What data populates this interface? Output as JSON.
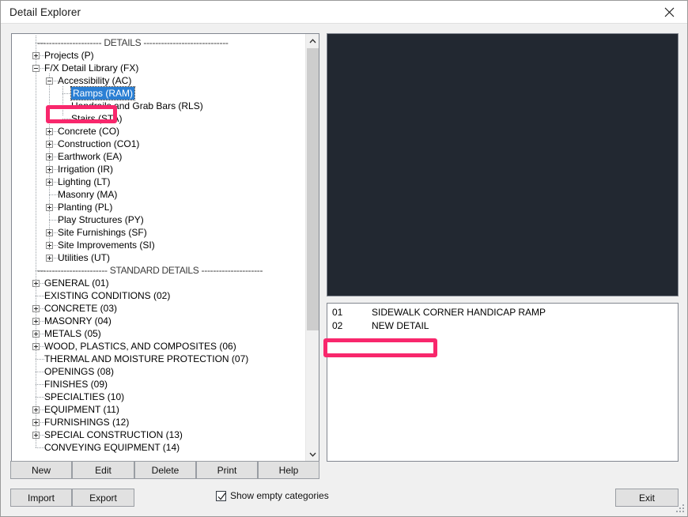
{
  "window": {
    "title": "Detail Explorer",
    "close_icon": "close-icon"
  },
  "tree": {
    "header_separator": "---------------------- DETAILS -----------------------------",
    "standard_separator": "------------------------ STANDARD DETAILS ---------------------",
    "selected_item": "Ramps (RAM)",
    "items": [
      {
        "label": "---------------------- DETAILS -----------------------------",
        "depth": 0,
        "toggle": "none",
        "type": "separator"
      },
      {
        "label": "Projects (P)",
        "depth": 0,
        "toggle": "plus"
      },
      {
        "label": "F/X Detail Library (FX)",
        "depth": 0,
        "toggle": "minus"
      },
      {
        "label": "Accessibility (AC)",
        "depth": 1,
        "toggle": "minus"
      },
      {
        "label": "Ramps (RAM)",
        "depth": 2,
        "toggle": "none",
        "selected": true
      },
      {
        "label": "Handrails and Grab Bars (RLS)",
        "depth": 2,
        "toggle": "none"
      },
      {
        "label": "Stairs (STA)",
        "depth": 2,
        "toggle": "none"
      },
      {
        "label": "Concrete (CO)",
        "depth": 1,
        "toggle": "plus"
      },
      {
        "label": "Construction (CO1)",
        "depth": 1,
        "toggle": "plus"
      },
      {
        "label": "Earthwork (EA)",
        "depth": 1,
        "toggle": "plus"
      },
      {
        "label": "Irrigation (IR)",
        "depth": 1,
        "toggle": "plus"
      },
      {
        "label": "Lighting (LT)",
        "depth": 1,
        "toggle": "plus"
      },
      {
        "label": "Masonry (MA)",
        "depth": 1,
        "toggle": "none"
      },
      {
        "label": "Planting (PL)",
        "depth": 1,
        "toggle": "plus"
      },
      {
        "label": "Play Structures (PY)",
        "depth": 1,
        "toggle": "none"
      },
      {
        "label": "Site Furnishings (SF)",
        "depth": 1,
        "toggle": "plus"
      },
      {
        "label": "Site Improvements (SI)",
        "depth": 1,
        "toggle": "plus"
      },
      {
        "label": "Utilities (UT)",
        "depth": 1,
        "toggle": "plus"
      },
      {
        "label": "------------------------ STANDARD DETAILS ---------------------",
        "depth": 0,
        "toggle": "none",
        "type": "separator"
      },
      {
        "label": "GENERAL (01)",
        "depth": 0,
        "toggle": "plus"
      },
      {
        "label": "EXISTING CONDITIONS (02)",
        "depth": 0,
        "toggle": "none"
      },
      {
        "label": "CONCRETE (03)",
        "depth": 0,
        "toggle": "plus"
      },
      {
        "label": "MASONRY (04)",
        "depth": 0,
        "toggle": "plus"
      },
      {
        "label": "METALS (05)",
        "depth": 0,
        "toggle": "plus"
      },
      {
        "label": "WOOD, PLASTICS, AND COMPOSITES (06)",
        "depth": 0,
        "toggle": "plus"
      },
      {
        "label": "THERMAL AND MOISTURE PROTECTION (07)",
        "depth": 0,
        "toggle": "none"
      },
      {
        "label": "OPENINGS (08)",
        "depth": 0,
        "toggle": "none"
      },
      {
        "label": "FINISHES (09)",
        "depth": 0,
        "toggle": "none"
      },
      {
        "label": "SPECIALTIES (10)",
        "depth": 0,
        "toggle": "none"
      },
      {
        "label": "EQUIPMENT (11)",
        "depth": 0,
        "toggle": "plus"
      },
      {
        "label": "FURNISHINGS (12)",
        "depth": 0,
        "toggle": "plus"
      },
      {
        "label": "SPECIAL CONSTRUCTION (13)",
        "depth": 0,
        "toggle": "plus"
      },
      {
        "label": "CONVEYING EQUIPMENT (14)",
        "depth": 0,
        "toggle": "none"
      }
    ],
    "scrollbar": {
      "up_icon": "chevron-up-icon",
      "down_icon": "chevron-down-icon"
    }
  },
  "preview": {
    "background_color": "#222831"
  },
  "detail_list": {
    "rows": [
      {
        "number": "01",
        "name": "SIDEWALK CORNER HANDICAP RAMP"
      },
      {
        "number": "02",
        "name": "NEW DETAIL",
        "highlighted": true
      }
    ]
  },
  "toolbar": {
    "new_label": "New",
    "edit_label": "Edit",
    "delete_label": "Delete",
    "print_label": "Print",
    "help_label": "Help",
    "import_label": "Import",
    "export_label": "Export",
    "exit_label": "Exit"
  },
  "options": {
    "show_empty_categories_label": "Show empty categories",
    "show_empty_categories_checked": true,
    "check_icon": "check-icon"
  },
  "annotations": {
    "color": "#f8276c",
    "tree_target": "Ramps (RAM)",
    "list_target": "02 NEW DETAIL"
  }
}
